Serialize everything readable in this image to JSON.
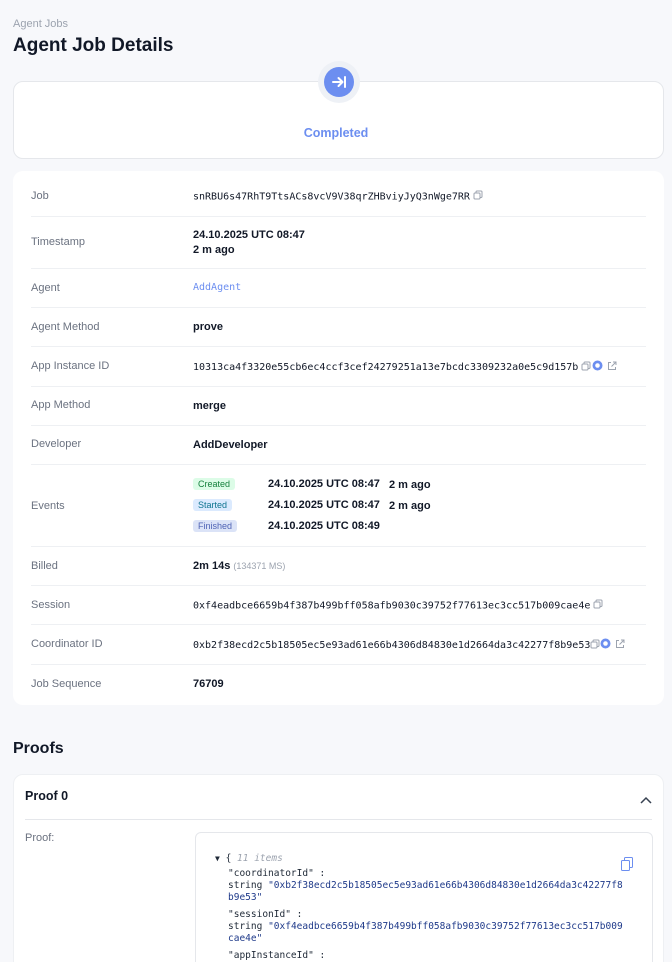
{
  "breadcrumb": "Agent Jobs",
  "title": "Agent Job Details",
  "status": "Completed",
  "details": {
    "job": {
      "label": "Job",
      "value": "snRBU6s47RhT9TtsACs8vcV9V38qrZHBviyJyQ3nWge7RR"
    },
    "timestamp": {
      "label": "Timestamp",
      "value": "24.10.2025 UTC 08:47",
      "relative": "2 m ago"
    },
    "agent": {
      "label": "Agent",
      "value": "AddAgent"
    },
    "agent_method": {
      "label": "Agent Method",
      "value": "prove"
    },
    "app_instance": {
      "label": "App Instance ID",
      "value": "10313ca4f3320e55cb6ec4ccf3cef24279251a13e7bcdc3309232a0e5c9d157b"
    },
    "app_method": {
      "label": "App Method",
      "value": "merge"
    },
    "developer": {
      "label": "Developer",
      "value": "AddDeveloper"
    },
    "events": {
      "label": "Events",
      "items": [
        {
          "badge": "Created",
          "time": "24.10.2025 UTC 08:47",
          "relative": "2 m ago"
        },
        {
          "badge": "Started",
          "time": "24.10.2025 UTC 08:47",
          "relative": "2 m ago"
        },
        {
          "badge": "Finished",
          "time": "24.10.2025 UTC 08:49",
          "relative": ""
        }
      ]
    },
    "billed": {
      "label": "Billed",
      "value": "2m 14s",
      "extra": "(134371 MS)"
    },
    "session": {
      "label": "Session",
      "value": "0xf4eadbce6659b4f387b499bff058afb9030c39752f77613ec3cc517b009cae4e"
    },
    "coordinator": {
      "label": "Coordinator ID",
      "value": "0xb2f38ecd2c5b18505ec5e93ad61e66b4306d84830e1d2664da3c42277f8b9e53"
    },
    "sequence": {
      "label": "Job Sequence",
      "value": "76709"
    }
  },
  "proofs": {
    "title": "Proofs",
    "proof_title": "Proof 0",
    "proof_label": "Proof:",
    "json": {
      "open": "{",
      "count": "11 items",
      "k1": "\"coordinatorId\" :",
      "t1": "string",
      "v1a": "\"0xb2f38ecd2c5b18505ec5e93ad61e66b4306d84830e1d2664da3c42277f8",
      "v1b": "b9e53\"",
      "k2": "\"sessionId\" :",
      "t2": "string",
      "v2a": "\"0xf4eadbce6659b4f387b499bff058afb9030c39752f77613ec3cc517b009",
      "v2b": "cae4e\"",
      "k3": "\"appInstanceId\" :"
    }
  },
  "colors": {
    "accent": "#6c8ef0"
  }
}
